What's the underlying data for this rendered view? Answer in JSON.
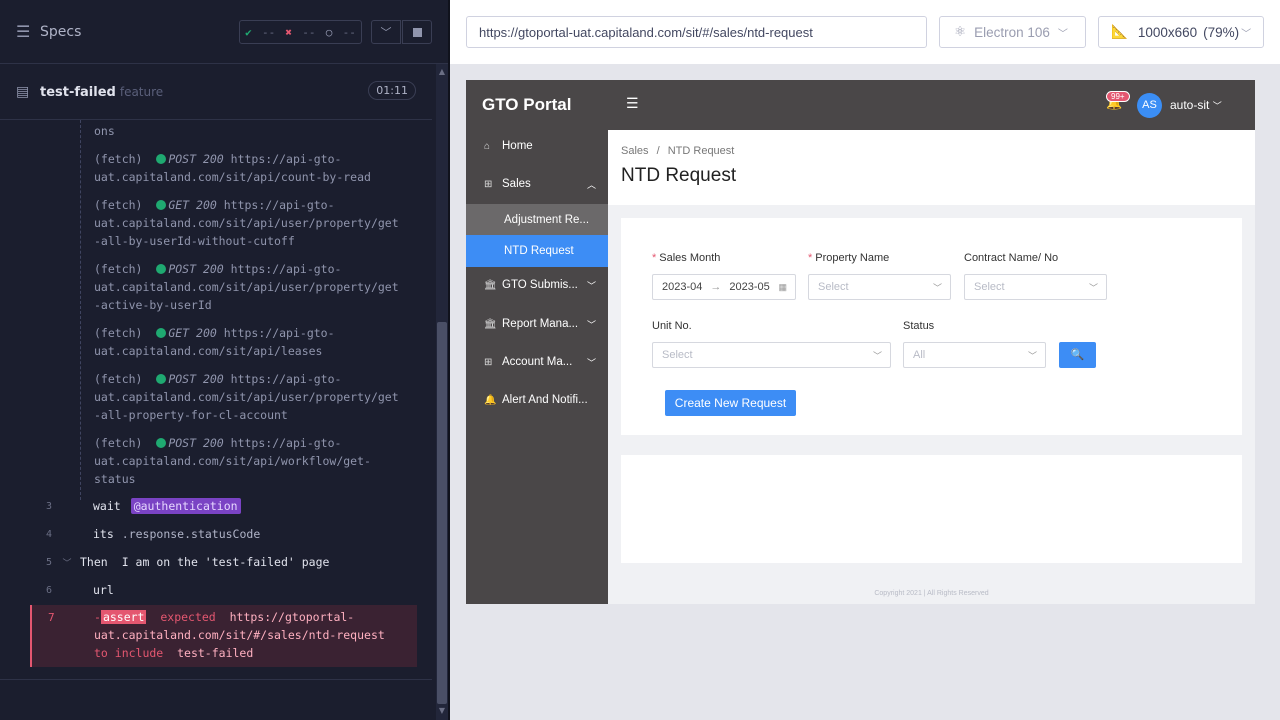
{
  "reporter": {
    "specs_label": "Specs",
    "stats": {
      "passed": "--",
      "failed": "--",
      "pending": "--"
    },
    "spec_file": {
      "name": "test-failed",
      "ext": "feature",
      "duration": "01:11"
    },
    "fetch_lines": [
      {
        "text": "ons"
      },
      {
        "prefix": "(fetch)",
        "method": "POST 200",
        "url1": "https://api-gto-",
        "url2": "uat.capitaland.com/sit/api/count-by-read"
      },
      {
        "prefix": "(fetch)",
        "method": "GET 200",
        "url1": "https://api-gto-",
        "url2": "uat.capitaland.com/sit/api/user/property/get",
        "url3": "-all-by-userId-without-cutoff"
      },
      {
        "prefix": "(fetch)",
        "method": "POST 200",
        "url1": "https://api-gto-",
        "url2": "uat.capitaland.com/sit/api/user/property/get",
        "url3": "-active-by-userId"
      },
      {
        "prefix": "(fetch)",
        "method": "GET 200",
        "url1": "https://api-gto-",
        "url2": "uat.capitaland.com/sit/api/leases"
      },
      {
        "prefix": "(fetch)",
        "method": "POST 200",
        "url1": "https://api-gto-",
        "url2": "uat.capitaland.com/sit/api/user/property/get",
        "url3": "-all-property-for-cl-account"
      },
      {
        "prefix": "(fetch)",
        "method": "POST 200",
        "url1": "https://api-gto-",
        "url2": "uat.capitaland.com/sit/api/workflow/get-",
        "url3": "status"
      }
    ],
    "commands": [
      {
        "num": "3",
        "name": "wait",
        "alias": "@authentication"
      },
      {
        "num": "4",
        "name": "its",
        "msg": ".response.statusCode"
      },
      {
        "num": "5",
        "name": "Then",
        "msg": "I am on the 'test-failed' page"
      },
      {
        "num": "6",
        "name": "url"
      }
    ],
    "failed": {
      "num": "7",
      "dash": "-",
      "badge": "assert",
      "expected": "expected",
      "url1": "https://gtoportal-",
      "url2": "uat.capitaland.com/sit/#/sales/ntd-request",
      "to_include": "to include",
      "value": "test-failed"
    }
  },
  "browser": {
    "url": "https://gtoportal-uat.capitaland.com/sit/#/sales/ntd-request",
    "name": "Electron 106",
    "viewport": "1000x660",
    "scale": "(79%)"
  },
  "app": {
    "logo": "GTO Portal",
    "notif_badge": "99+",
    "avatar": "AS",
    "user": "auto-sit",
    "nav": {
      "home": "Home",
      "sales": "Sales",
      "adjustment": "Adjustment Re...",
      "ntd": "NTD Request",
      "gto": "GTO Submis...",
      "report": "Report Mana...",
      "account": "Account Ma...",
      "alert": "Alert And Notifi..."
    },
    "breadcrumb": {
      "parent": "Sales",
      "sep": "/",
      "current": "NTD Request"
    },
    "title": "NTD Request",
    "filters": {
      "sales_month_label": "Sales Month",
      "date_from": "2023-04",
      "date_to": "2023-05",
      "property_label": "Property Name",
      "property_placeholder": "Select",
      "contract_label": "Contract Name/ No",
      "contract_placeholder": "Select",
      "unit_label": "Unit No.",
      "unit_placeholder": "Select",
      "status_label": "Status",
      "status_value": "All"
    },
    "create_button": "Create New Request",
    "copyright": "Copyright 2021 | All Rights Reserved"
  }
}
